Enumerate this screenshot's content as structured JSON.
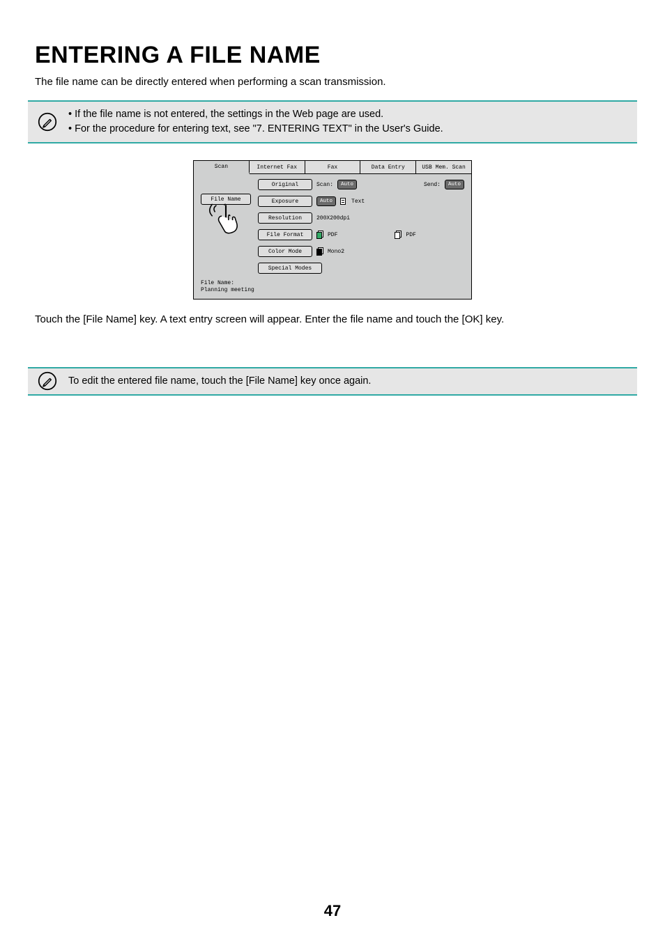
{
  "heading": "ENTERING A FILE NAME",
  "intro": "The file name can be directly entered when performing a scan transmission.",
  "note1": {
    "line1": "• If the file name is not entered, the settings in the Web page are used.",
    "line2": "• For the procedure for entering text, see \"7. ENTERING TEXT\" in the User's Guide."
  },
  "panel": {
    "tabs": {
      "scan": "Scan",
      "ifax": "Internet Fax",
      "fax": "Fax",
      "data": "Data Entry",
      "usb": "USB Mem. Scan"
    },
    "left": {
      "file_name_btn": "File Name"
    },
    "rows": {
      "original": {
        "btn": "Original",
        "scan_label": "Scan:",
        "scan_val": "Auto",
        "send_label": "Send:",
        "send_val": "Auto"
      },
      "exposure": {
        "btn": "Exposure",
        "mode": "Auto",
        "type": "Text"
      },
      "resolution": {
        "btn": "Resolution",
        "value": "200X200dpi"
      },
      "format": {
        "btn": "File Format",
        "v1": "PDF",
        "v2": "PDF"
      },
      "color": {
        "btn": "Color Mode",
        "value": "Mono2"
      },
      "special": {
        "btn": "Special Modes"
      }
    },
    "footer": {
      "label": "File Name:",
      "value": "Planning meeting"
    }
  },
  "instruction": "Touch the [File Name] key. A text entry screen will appear. Enter the file name and touch the [OK] key.",
  "note2": "To edit the entered file name, touch the [File Name] key once again.",
  "page_number": "47"
}
